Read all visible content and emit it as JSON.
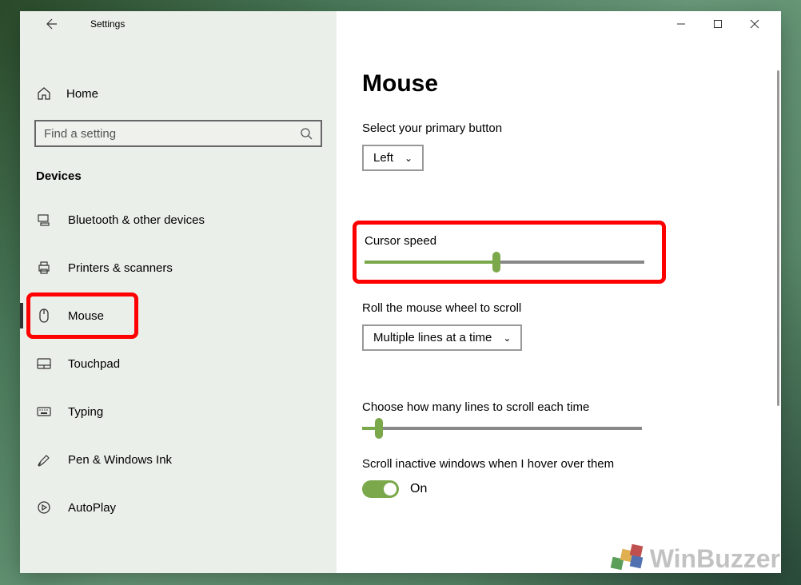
{
  "titlebar": {
    "title": "Settings"
  },
  "sidebar": {
    "home": "Home",
    "search_placeholder": "Find a setting",
    "category": "Devices",
    "items": [
      {
        "label": "Bluetooth & other devices"
      },
      {
        "label": "Printers & scanners"
      },
      {
        "label": "Mouse"
      },
      {
        "label": "Touchpad"
      },
      {
        "label": "Typing"
      },
      {
        "label": "Pen & Windows Ink"
      },
      {
        "label": "AutoPlay"
      }
    ]
  },
  "content": {
    "heading": "Mouse",
    "primary_button_label": "Select your primary button",
    "primary_button_value": "Left",
    "cursor_speed_label": "Cursor speed",
    "scroll_mode_label": "Roll the mouse wheel to scroll",
    "scroll_mode_value": "Multiple lines at a time",
    "lines_label": "Choose how many lines to scroll each time",
    "inactive_label": "Scroll inactive windows when I hover over them",
    "inactive_value": "On"
  },
  "watermark": "WinBuzzer"
}
